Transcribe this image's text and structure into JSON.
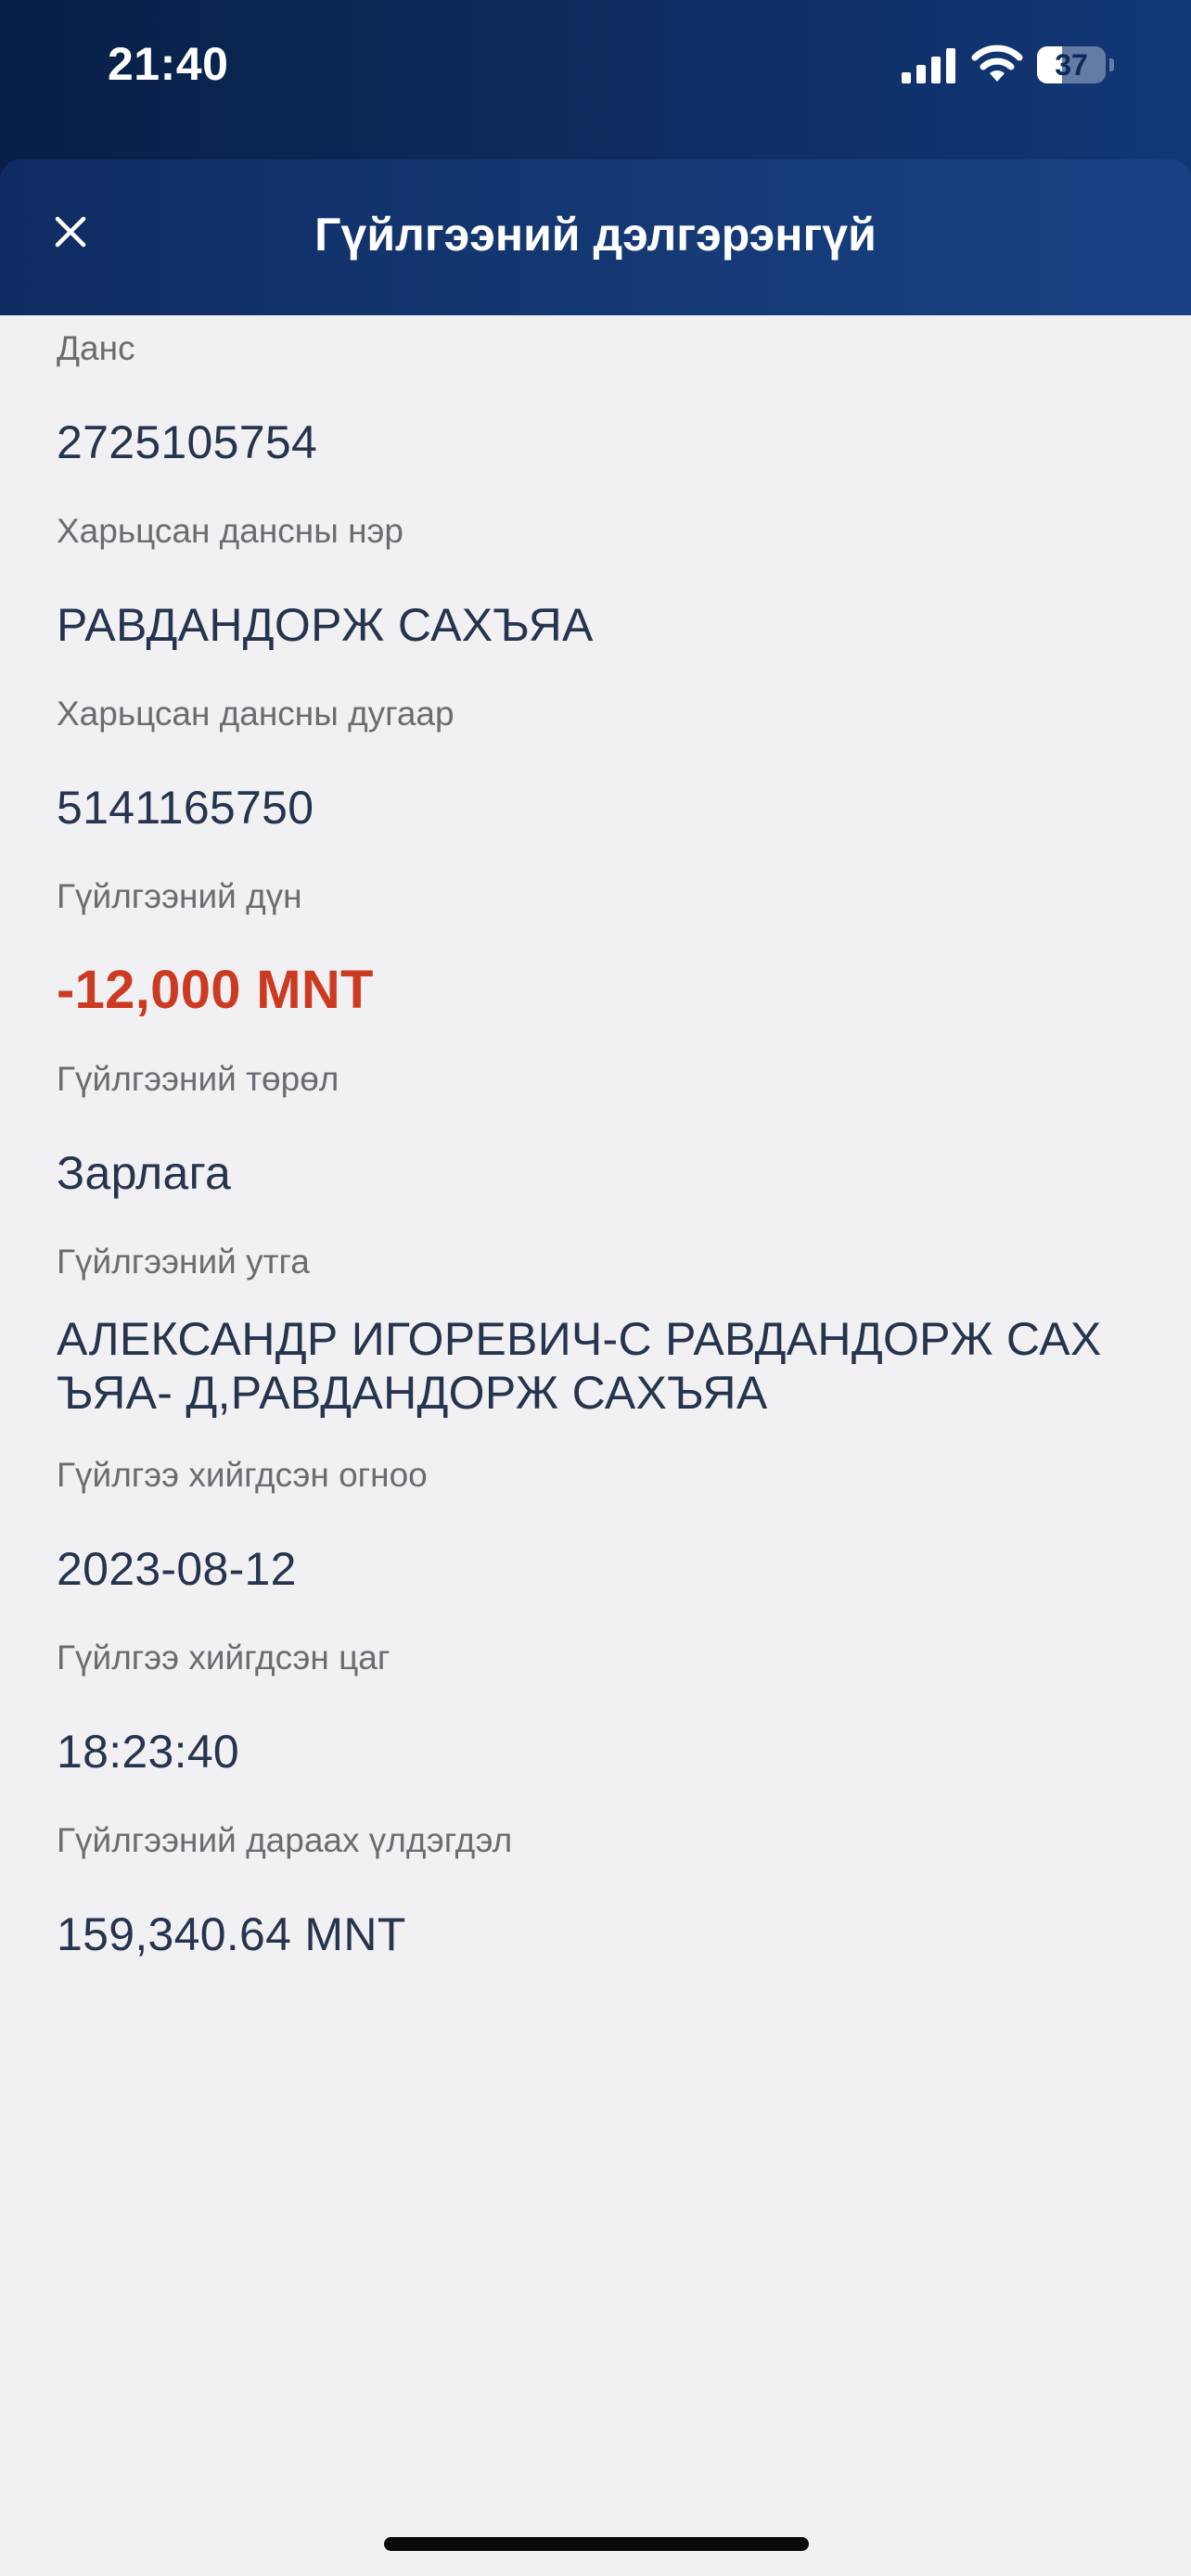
{
  "status_bar": {
    "time": "21:40",
    "battery_level": "37",
    "battery_fraction": 0.37
  },
  "header": {
    "title": "Гүйлгээний дэлгэрэнгүй",
    "close_icon": "close-icon"
  },
  "details": [
    {
      "label": "Данс",
      "value": "2725105754"
    },
    {
      "label": "Харьцсан дансны нэр",
      "value": "РАВДАНДОРЖ САХЪЯА"
    },
    {
      "label": "Харьцсан дансны дугаар",
      "value": "5141165750"
    },
    {
      "label": "Гүйлгээний дүн",
      "value": "-12,000 MNT"
    },
    {
      "label": "Гүйлгээний төрөл",
      "value": "Зарлага"
    },
    {
      "label": "Гүйлгээний утга",
      "value": "АЛЕКСАНДР ИГОРЕВИЧ-С РАВДАНДОРЖ САХ ЪЯА- Д,РАВДАНДОРЖ САХЪЯА"
    },
    {
      "label": "Гүйлгээ хийгдсэн огноо",
      "value": "2023-08-12"
    },
    {
      "label": "Гүйлгээ хийгдсэн цаг",
      "value": "18:23:40"
    },
    {
      "label": "Гүйлгээний дараах үлдэгдэл",
      "value": "159,340.64 MNT"
    }
  ],
  "colors": {
    "header_gradient_start": "#0f2c62",
    "header_gradient_end": "#1a4185",
    "background": "#f1f1f4",
    "label": "#6b6b72",
    "value": "#26344d",
    "negative_amount": "#cc3a22"
  }
}
